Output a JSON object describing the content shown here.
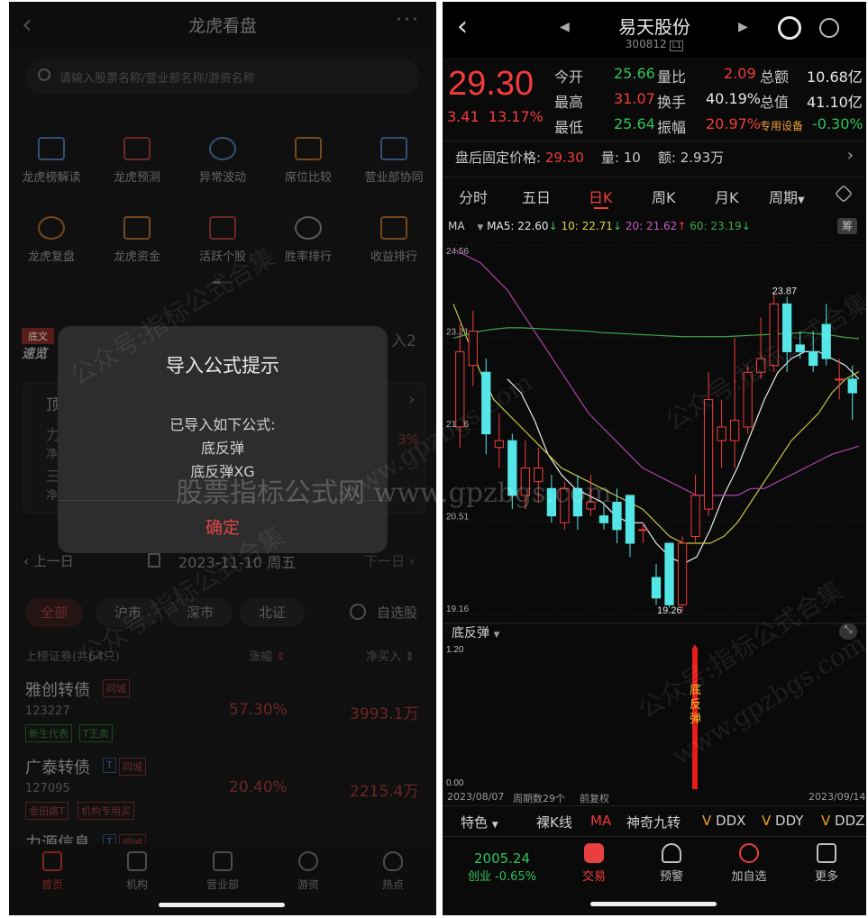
{
  "left": {
    "title": "龙虎看盘",
    "more": "···",
    "search_placeholder": "请输入股票名称/营业部名称/游资名称",
    "grid": [
      {
        "label": "龙虎榜解读",
        "icon": "book-star-icon"
      },
      {
        "label": "龙虎预测",
        "icon": "trend-chart-icon"
      },
      {
        "label": "异常波动",
        "icon": "pulse-icon"
      },
      {
        "label": "席位比较",
        "icon": "compare-icon"
      },
      {
        "label": "营业部协同",
        "icon": "document-icon"
      },
      {
        "label": "龙虎复盘",
        "icon": "review-icon"
      },
      {
        "label": "龙虎资金",
        "icon": "fund-icon"
      },
      {
        "label": "活跃个股",
        "icon": "active-stock-icon"
      },
      {
        "label": "胜率排行",
        "icon": "medal-icon"
      },
      {
        "label": "收益排行",
        "icon": "bar-growth-icon"
      }
    ],
    "banner_tag_top": "底文",
    "banner_tag_bottom": "速览",
    "banner_suffix": "入2",
    "card_title": "顶级",
    "card_lines": [
      "力源",
      "净买",
      "三超",
      "净买"
    ],
    "card_pct": "3%",
    "dialog": {
      "title": "导入公式提示",
      "line1": "已导入如下公式:",
      "line2": "底反弹",
      "line3": "底反弹XG",
      "ok": "确定"
    },
    "date_prev": "上一日",
    "date": "2023-11-10 周五",
    "date_next": "下一日",
    "filters": [
      "全部",
      "沪市",
      "深市",
      "北证"
    ],
    "watch_label": "自选股",
    "list_header": {
      "name": "上榜证券(共64只)",
      "pct": "涨幅",
      "buy": "净买入"
    },
    "rows": [
      {
        "name": "雅创转债",
        "code": "123227",
        "pct": "57.30%",
        "amt": "3993.1万",
        "tag": "同城",
        "badges": [
          "新生代表",
          "T王卖"
        ]
      },
      {
        "name": "广泰转债",
        "code": "127095",
        "pct": "20.40%",
        "amt": "2215.4万",
        "tag": "同城",
        "tag_t": "T",
        "badges": [
          "金田路T",
          "机构专用买"
        ]
      },
      {
        "name": "力源信息",
        "tag_t": "T",
        "tag": "同城"
      }
    ],
    "tabs": [
      {
        "label": "首页",
        "icon": "home-icon"
      },
      {
        "label": "机构",
        "icon": "building-icon"
      },
      {
        "label": "营业部",
        "icon": "branch-icon"
      },
      {
        "label": "游资",
        "icon": "yen-coin-icon"
      },
      {
        "label": "热点",
        "icon": "flame-icon"
      }
    ]
  },
  "right": {
    "stock_name": "易天股份",
    "stock_code": "300812",
    "code_badge": "L1",
    "price": "29.30",
    "change": "3.41",
    "change_pct": "13.17%",
    "quote": [
      {
        "label": "今开",
        "value": "25.66",
        "color": "#2fc25b"
      },
      {
        "label": "量比",
        "value": "2.09",
        "color": "#f23c3c"
      },
      {
        "label": "总额",
        "value": "10.68亿",
        "color": "#e6e6e6"
      },
      {
        "label": "最高",
        "value": "31.07",
        "color": "#f23c3c"
      },
      {
        "label": "换手",
        "value": "40.19%",
        "color": "#e6e6e6"
      },
      {
        "label": "总值",
        "value": "41.10亿",
        "color": "#e6e6e6"
      },
      {
        "label": "最低",
        "value": "25.64",
        "color": "#2fc25b"
      },
      {
        "label": "振幅",
        "value": "20.97%",
        "color": "#f23c3c"
      },
      {
        "label": "专用设备",
        "value": "-0.30%",
        "color": "#2fc25b"
      }
    ],
    "after_hours": {
      "label": "盘后固定价格:",
      "price": "29.30",
      "vol_label": "量:",
      "vol": "10",
      "amt_label": "额:",
      "amt": "2.93万"
    },
    "period_tabs": [
      "分时",
      "五日",
      "日K",
      "周K",
      "月K",
      "周期"
    ],
    "ma": {
      "label": "MA",
      "ma5": "MA5: 22.60",
      "ma10": "10: 22.71",
      "ma20": "20: 21.62",
      "ma60": "60: 23.19",
      "badge": "筹"
    },
    "y_ticks": [
      "24.56",
      "23.21",
      "21.86",
      "20.51",
      "19.16"
    ],
    "high_label": "23.87",
    "low_label": "19.26",
    "indicator": {
      "name": "底反弹",
      "top": "1.20",
      "bottom": "0.00",
      "signal": "底反弹"
    },
    "footer": {
      "start": "2023/08/07",
      "count": "周期数29个",
      "adj": "前复权",
      "end": "2023/09/14"
    },
    "tools": [
      "特色",
      "裸K线",
      "MA",
      "神奇九转",
      "DDX",
      "DDY",
      "DDZ"
    ],
    "index": {
      "value": "2005.24",
      "label": "创业 -0.65%"
    },
    "tabs": [
      {
        "label": "交易",
        "icon": "trade-icon"
      },
      {
        "label": "预警",
        "icon": "bell-icon"
      },
      {
        "label": "加自选",
        "icon": "add-watch-icon"
      },
      {
        "label": "更多",
        "icon": "grid-icon"
      }
    ]
  },
  "watermarks": {
    "center": "股票指标公式网 www.gpzbgs.com",
    "diag1": "公众号:指标公式合集",
    "diag2": "www.gpzbgs.com"
  },
  "chart_data": {
    "type": "candlestick",
    "ylim": [
      19.16,
      24.56
    ],
    "x": [
      "2023/08/07",
      "2023/09/14"
    ],
    "candles": [
      {
        "o": 21.9,
        "c": 23.0,
        "h": 23.4,
        "l": 21.6
      },
      {
        "o": 22.8,
        "c": 23.3,
        "h": 23.6,
        "l": 22.5
      },
      {
        "o": 22.7,
        "c": 21.8,
        "h": 22.9,
        "l": 21.5
      },
      {
        "o": 21.6,
        "c": 21.7,
        "h": 22.1,
        "l": 21.3
      },
      {
        "o": 21.7,
        "c": 20.9,
        "h": 21.8,
        "l": 20.7
      },
      {
        "o": 20.9,
        "c": 21.3,
        "h": 21.7,
        "l": 20.7
      },
      {
        "o": 21.1,
        "c": 21.3,
        "h": 21.6,
        "l": 20.8
      },
      {
        "o": 21.0,
        "c": 20.6,
        "h": 21.2,
        "l": 20.5
      },
      {
        "o": 20.5,
        "c": 21.0,
        "h": 21.1,
        "l": 20.4
      },
      {
        "o": 21.0,
        "c": 20.6,
        "h": 21.2,
        "l": 20.4
      },
      {
        "o": 20.7,
        "c": 20.8,
        "h": 21.2,
        "l": 20.6
      },
      {
        "o": 20.6,
        "c": 20.5,
        "h": 20.8,
        "l": 20.4
      },
      {
        "o": 20.8,
        "c": 20.4,
        "h": 21.0,
        "l": 20.2
      },
      {
        "o": 20.9,
        "c": 20.2,
        "h": 20.9,
        "l": 20.0
      },
      {
        "o": 20.4,
        "c": 20.4,
        "h": 20.5,
        "l": 20.2
      },
      {
        "o": 19.7,
        "c": 19.4,
        "h": 19.9,
        "l": 19.3
      },
      {
        "o": 20.2,
        "c": 19.3,
        "h": 20.2,
        "l": 19.26
      },
      {
        "o": 19.3,
        "c": 20.2,
        "h": 20.3,
        "l": 19.2
      },
      {
        "o": 20.3,
        "c": 20.9,
        "h": 21.2,
        "l": 20.2
      },
      {
        "o": 20.7,
        "c": 22.3,
        "h": 22.7,
        "l": 20.6
      },
      {
        "o": 21.7,
        "c": 21.9,
        "h": 22.3,
        "l": 21.3
      },
      {
        "o": 21.7,
        "c": 22.0,
        "h": 23.2,
        "l": 21.3
      },
      {
        "o": 21.9,
        "c": 22.7,
        "h": 22.8,
        "l": 21.8
      },
      {
        "o": 22.7,
        "c": 22.9,
        "h": 23.5,
        "l": 22.6
      },
      {
        "o": 22.8,
        "c": 23.7,
        "h": 23.87,
        "l": 22.7
      },
      {
        "o": 23.7,
        "c": 23.0,
        "h": 23.8,
        "l": 22.7
      },
      {
        "o": 23.1,
        "c": 23.0,
        "h": 23.3,
        "l": 22.9
      },
      {
        "o": 23.0,
        "c": 22.8,
        "h": 23.3,
        "l": 22.7
      },
      {
        "o": 23.4,
        "c": 22.9,
        "h": 23.7,
        "l": 22.8
      },
      {
        "o": 22.6,
        "c": 22.6,
        "h": 22.9,
        "l": 22.3
      },
      {
        "o": 22.6,
        "c": 22.4,
        "h": 22.8,
        "l": 22.0
      }
    ],
    "ma_lines": [
      {
        "name": "MA5",
        "color": "#e8e8e8",
        "values": [
          null,
          null,
          null,
          null,
          22.6,
          22.4,
          22.0,
          21.5,
          21.2,
          21.0,
          20.9,
          20.8,
          20.6,
          20.5,
          20.5,
          20.2,
          20.0,
          19.9,
          20.0,
          20.4,
          20.9,
          21.3,
          21.8,
          22.3,
          22.7,
          22.9,
          23.0,
          23.0,
          22.9,
          22.8,
          22.6
        ]
      },
      {
        "name": "MA10",
        "color": "#c8c84a",
        "values": [
          23.7,
          23.2,
          22.7,
          22.3,
          22.1,
          21.9,
          21.7,
          21.5,
          21.3,
          21.2,
          21.1,
          21.0,
          20.9,
          20.8,
          20.7,
          20.5,
          20.3,
          20.2,
          20.2,
          20.2,
          20.3,
          20.5,
          20.8,
          21.1,
          21.4,
          21.7,
          21.9,
          22.1,
          22.4,
          22.6,
          22.71
        ]
      },
      {
        "name": "MA20",
        "color": "#b044b0",
        "values": [
          24.5,
          24.4,
          24.3,
          24.1,
          23.9,
          23.6,
          23.3,
          23.0,
          22.7,
          22.4,
          22.1,
          21.9,
          21.7,
          21.5,
          21.3,
          21.2,
          21.1,
          21.0,
          20.9,
          20.9,
          20.9,
          20.9,
          21.0,
          21.0,
          21.1,
          21.2,
          21.3,
          21.4,
          21.5,
          21.56,
          21.62
        ]
      },
      {
        "name": "MA60",
        "color": "#3aa84a",
        "values": [
          23.2,
          23.25,
          23.3,
          23.33,
          23.35,
          23.35,
          23.34,
          23.33,
          23.32,
          23.31,
          23.3,
          23.28,
          23.27,
          23.26,
          23.25,
          23.24,
          23.23,
          23.22,
          23.22,
          23.22,
          23.22,
          23.23,
          23.24,
          23.25,
          23.26,
          23.27,
          23.28,
          23.26,
          23.24,
          23.21,
          23.19
        ]
      }
    ]
  }
}
